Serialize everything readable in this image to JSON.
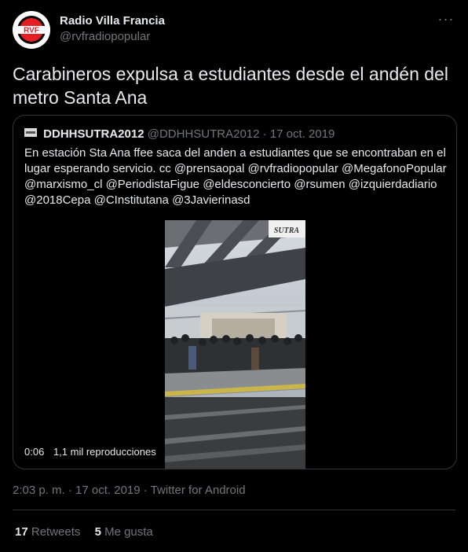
{
  "author": {
    "name": "Radio Villa Francia",
    "handle": "@rvfradiopopular",
    "avatar_text": "RVF"
  },
  "tweet": {
    "text": "Carabineros expulsa a estudiantes desde el andén del metro Santa Ana"
  },
  "quoted": {
    "name": "DDHHSUTRA2012",
    "handle": "@DDHHSUTRA2012",
    "separator": "·",
    "date": "17 oct. 2019",
    "text": "En estación Sta Ana ffee saca del anden a estudiantes que se encontraban en el lugar esperando servicio. cc @prensaopal @rvfradiopopular @MegafonoPopular @marxismo_cl @PeriodistaFigue @eldesconcierto @rsumen @izquierdadiario @2018Cepa @CInstitutana @3Javierinasd",
    "video": {
      "duration": "0:06",
      "views": "1,1 mil reproducciones",
      "sign_text": "SUTRA"
    }
  },
  "meta": "2:03 p. m. · 17 oct. 2019 · Twitter for Android",
  "stats": {
    "retweets_count": "17",
    "retweets_label": "Retweets",
    "likes_count": "5",
    "likes_label": "Me gusta"
  },
  "colors": {
    "background": "#000000",
    "text": "#e7e9ea",
    "muted": "#71767b",
    "border": "#333639",
    "avatar_red": "#e31e24"
  },
  "icons": {
    "more": "more-icon",
    "flag": "flag-icon"
  }
}
